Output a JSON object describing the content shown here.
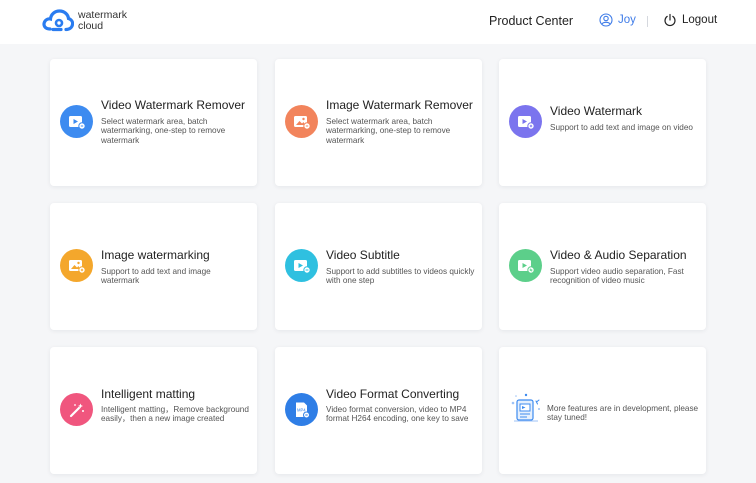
{
  "header": {
    "logo_line1": "watermark",
    "logo_line2": "cloud",
    "product_center": "Product Center",
    "user_name": "Joy",
    "logout": "Logout"
  },
  "cards": [
    {
      "title": "Video Watermark Remover",
      "desc": "Select watermark area, batch watermarking, one-step to remove watermark",
      "icon": "video-remove-icon",
      "color": "#3d8bf0"
    },
    {
      "title": "Image Watermark Remover",
      "desc": "Select watermark area, batch watermarking, one-step to remove watermark",
      "icon": "image-remove-icon",
      "color": "#f2845c"
    },
    {
      "title": "Video Watermark",
      "desc": "Support to add text and image on video",
      "icon": "video-watermark-icon",
      "color": "#7b74ee"
    },
    {
      "title": "Image watermarking",
      "desc": "Support to add text and image watermark",
      "icon": "image-watermark-icon",
      "color": "#f4a72c"
    },
    {
      "title": "Video Subtitle",
      "desc": "Support to add subtitles to videos quickly with one step",
      "icon": "video-subtitle-icon",
      "color": "#2fc0e0"
    },
    {
      "title": "Video & Audio Separation",
      "desc": "Support video audio separation, Fast recognition of video music",
      "icon": "audio-separation-icon",
      "color": "#5ccf8a"
    },
    {
      "title": "Intelligent matting",
      "desc": "Intelligent matting，Remove background easily，then a new image created",
      "icon": "magic-wand-icon",
      "color": "#f0567e"
    },
    {
      "title": "Video Format Converting",
      "desc": "Video format conversion, video to MP4 format H264 encoding, one key to save",
      "icon": "mp4-convert-icon",
      "color": "#2f7ee6"
    },
    {
      "title": "",
      "desc": "More features are in development, please stay tuned!",
      "icon": "coming-soon-icon",
      "color": "#3d8bf0"
    }
  ]
}
